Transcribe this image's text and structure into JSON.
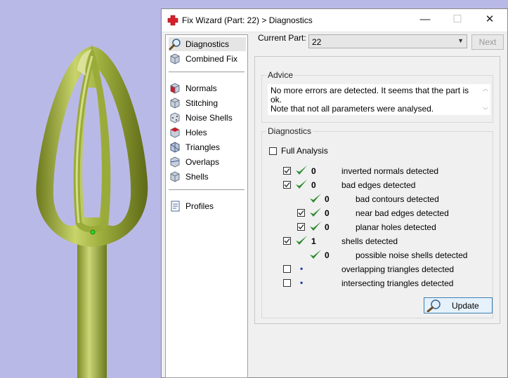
{
  "window": {
    "title": "Fix Wizard (Part: 22) > Diagnostics",
    "controls": {
      "minimize": "—",
      "maximize": "☐",
      "close": "✕"
    }
  },
  "sidebar": {
    "items": [
      {
        "label": "Diagnostics",
        "icon": "magnifier-icon",
        "selected": true
      },
      {
        "label": "Combined Fix",
        "icon": "combined-fix-icon"
      },
      {
        "label": "Normals",
        "icon": "normals-icon"
      },
      {
        "label": "Stitching",
        "icon": "stitching-icon"
      },
      {
        "label": "Noise Shells",
        "icon": "noise-shells-icon"
      },
      {
        "label": "Holes",
        "icon": "holes-icon"
      },
      {
        "label": "Triangles",
        "icon": "triangles-icon"
      },
      {
        "label": "Overlaps",
        "icon": "overlaps-icon"
      },
      {
        "label": "Shells",
        "icon": "shells-icon"
      },
      {
        "label": "Profiles",
        "icon": "profiles-icon"
      }
    ]
  },
  "current_part": {
    "label": "Current Part:",
    "value": "22"
  },
  "next_button": "Next",
  "advice": {
    "legend": "Advice",
    "line1": "No more errors are detected. It seems that the part is ok.",
    "line2": "Note that not all parameters were analysed."
  },
  "diagnostics": {
    "legend": "Diagnostics",
    "full_analysis_label": "Full Analysis",
    "rows": [
      {
        "count": "0",
        "label": "inverted normals detected"
      },
      {
        "count": "0",
        "label": "bad edges detected"
      },
      {
        "count": "0",
        "label": "bad contours detected"
      },
      {
        "count": "0",
        "label": "near bad edges detected"
      },
      {
        "count": "0",
        "label": "planar holes detected"
      },
      {
        "count": "1",
        "label": "shells detected"
      },
      {
        "count": "0",
        "label": "possible noise shells detected"
      },
      {
        "count": "•",
        "label": "overlapping triangles detected"
      },
      {
        "count": "•",
        "label": "intersecting triangles detected"
      }
    ],
    "update_button": "Update"
  },
  "colors": {
    "accent_green": "#2e8b2e",
    "update_border": "#3c7fb1",
    "viewport_bg": "#b9b9e8",
    "model_green": "#a8b44a"
  }
}
